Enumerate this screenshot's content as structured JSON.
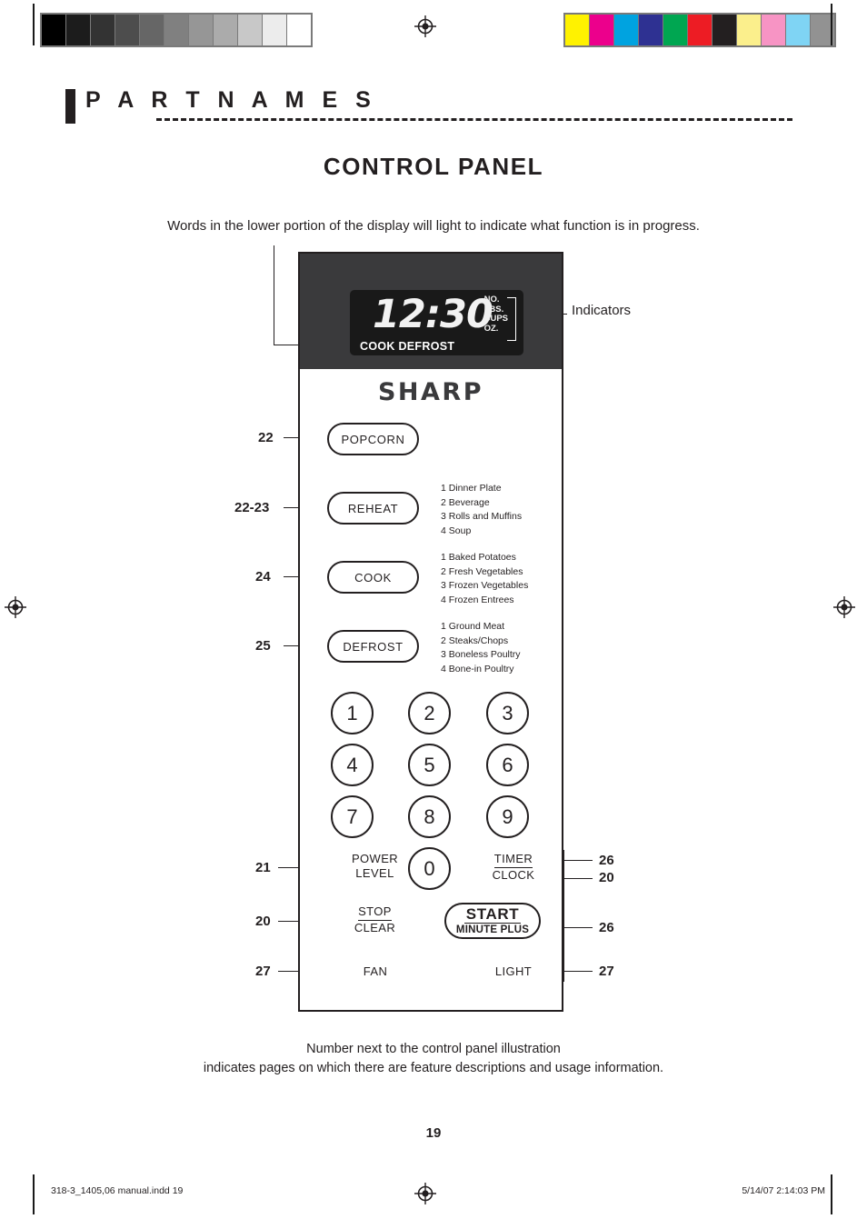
{
  "section": {
    "title": "P A R T   N A M E S"
  },
  "page": {
    "title": "CONTROL PANEL",
    "intro": "Words in the lower portion of the display will light to indicate what function is in progress.",
    "caption": "Number next to the control panel illustration\nindicates pages on which there are feature descriptions and usage information.",
    "number": "19"
  },
  "display": {
    "time": "12:30",
    "status_words": "COOK DEFROST",
    "indicators": "NO.\nLBS.\nCUPS\nOZ.",
    "indicators_label": "Indicators"
  },
  "brand": {
    "logo": "SHARP"
  },
  "buttons": {
    "popcorn": "POPCORN",
    "reheat": "REHEAT",
    "cook": "COOK",
    "defrost": "DEFROST",
    "power_level_line1": "POWER",
    "power_level_line2": "LEVEL",
    "stop": "STOP",
    "clear": "CLEAR",
    "fan": "FAN",
    "timer": "TIMER",
    "clock": "CLOCK",
    "light": "LIGHT",
    "start": "START",
    "minute_plus": "MINUTE PLUS"
  },
  "menus": {
    "reheat": "1 Dinner Plate\n2 Beverage\n3 Rolls and Muffins\n4 Soup",
    "cook": "1 Baked Potatoes\n2 Fresh Vegetables\n3 Frozen Vegetables\n4 Frozen Entrees",
    "defrost": "1 Ground Meat\n2 Steaks/Chops\n3 Boneless Poultry\n4 Bone-in Poultry"
  },
  "keypad": [
    "1",
    "2",
    "3",
    "4",
    "5",
    "6",
    "7",
    "8",
    "9",
    "0"
  ],
  "callouts": {
    "popcorn": "22",
    "reheat": "22-23",
    "cook": "24",
    "defrost": "25",
    "power_level": "21",
    "stop_clear": "20",
    "fan": "27",
    "timer": "26",
    "clock": "20",
    "start": "26",
    "light": "27"
  },
  "print_footer": {
    "file": "318-3_1405,06 manual.indd   19",
    "timestamp": "5/14/07   2:14:03 PM"
  },
  "calibration": {
    "gray_swatches": [
      "#000000",
      "#1c1c1c",
      "#333333",
      "#4d4d4d",
      "#666666",
      "#808080",
      "#969696",
      "#ababab",
      "#c8c8c8",
      "#ececec",
      "#ffffff"
    ],
    "color_swatches": [
      "#fff200",
      "#ec008c",
      "#00a3e0",
      "#2e3192",
      "#00a651",
      "#ed1c24",
      "#231f20",
      "#fbef8c",
      "#f794c4",
      "#7fd4f4",
      "#929292"
    ]
  }
}
